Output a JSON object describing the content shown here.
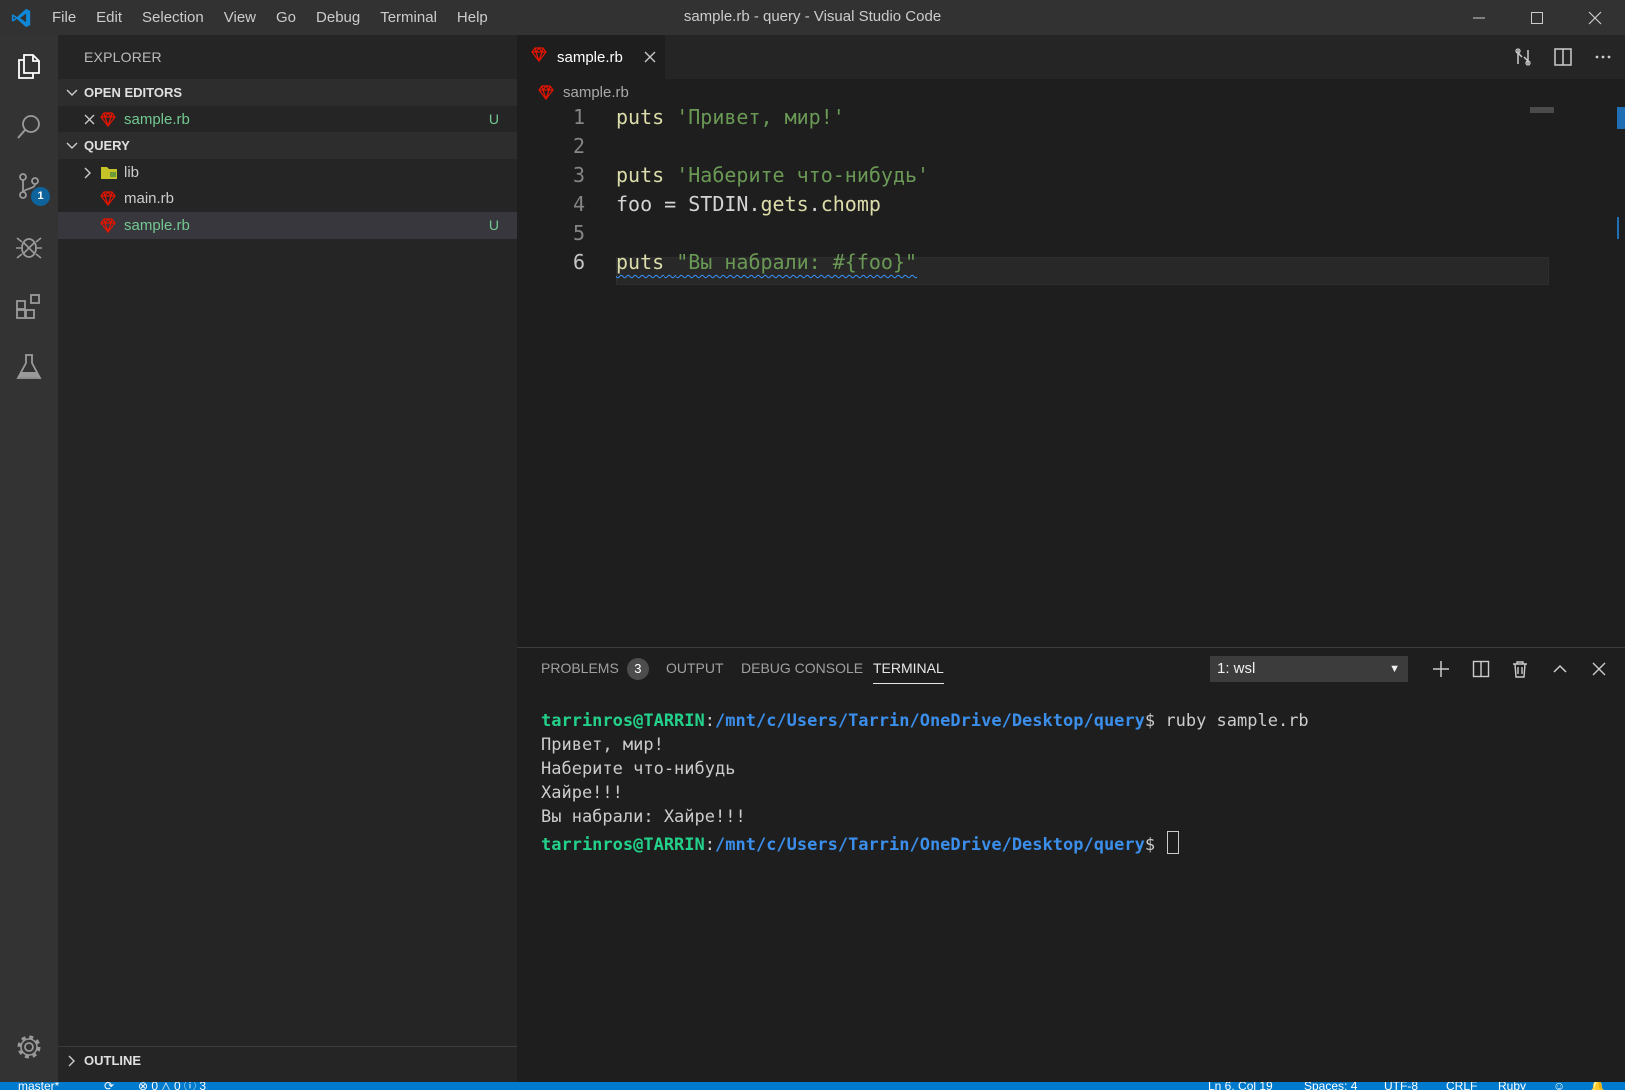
{
  "titlebar": {
    "title": "sample.rb - query - Visual Studio Code",
    "menu": [
      "File",
      "Edit",
      "Selection",
      "View",
      "Go",
      "Debug",
      "Terminal",
      "Help"
    ]
  },
  "activity": {
    "items": [
      "explorer-icon",
      "search-icon",
      "source-control-icon",
      "debug-icon",
      "extensions-icon",
      "test-icon"
    ],
    "source_control_badge": "1",
    "settings": "gear-icon"
  },
  "sidebar": {
    "title": "EXPLORER",
    "open_editors": {
      "header": "OPEN EDITORS",
      "items": [
        {
          "name": "sample.rb",
          "status": "U"
        }
      ]
    },
    "folder": {
      "header": "QUERY",
      "items": [
        {
          "name": "lib",
          "type": "folder"
        },
        {
          "name": "main.rb",
          "type": "file"
        },
        {
          "name": "sample.rb",
          "type": "file",
          "status": "U"
        }
      ]
    },
    "outline": "OUTLINE"
  },
  "editor": {
    "tab": "sample.rb",
    "breadcrumb": "sample.rb",
    "line_numbers": [
      "1",
      "2",
      "3",
      "4",
      "5",
      "6"
    ],
    "lines": {
      "l1_kw": "puts",
      "l1_str": "'Привет, мир!'",
      "l3_kw": "puts",
      "l3_str": "'Наберите что-нибудь'",
      "l4_a": "foo = STDIN.",
      "l4_m1": "gets",
      "l4_dot": ".",
      "l4_m2": "chomp",
      "l6_kw": "puts",
      "l6_str": "\"Вы набрали: #{foo}\""
    }
  },
  "panel": {
    "tabs": [
      "PROBLEMS",
      "OUTPUT",
      "DEBUG CONSOLE",
      "TERMINAL"
    ],
    "problems_count": "3",
    "terminal_select": "1: wsl",
    "terminal": {
      "user": "tarrinros@TARRIN",
      "sep": ":",
      "path": "/mnt/c/Users/Tarrin/OneDrive/Desktop/query",
      "prompt": "$",
      "command": " ruby sample.rb",
      "output": [
        "Привет, мир!",
        "Наберите что-нибудь",
        "Хайре!!!",
        "Вы набрали: Хайре!!!"
      ]
    }
  },
  "statusbar": {
    "branch": "master*",
    "errors": "0",
    "warnings": "0",
    "infos": "3",
    "position": "Ln 6, Col 19",
    "spaces": "Spaces: 4",
    "encoding": "UTF-8",
    "eol": "CRLF",
    "language": "Ruby"
  },
  "colors": {
    "accent": "#007acc",
    "untracked": "#73c991",
    "ruby": "#e51400"
  }
}
